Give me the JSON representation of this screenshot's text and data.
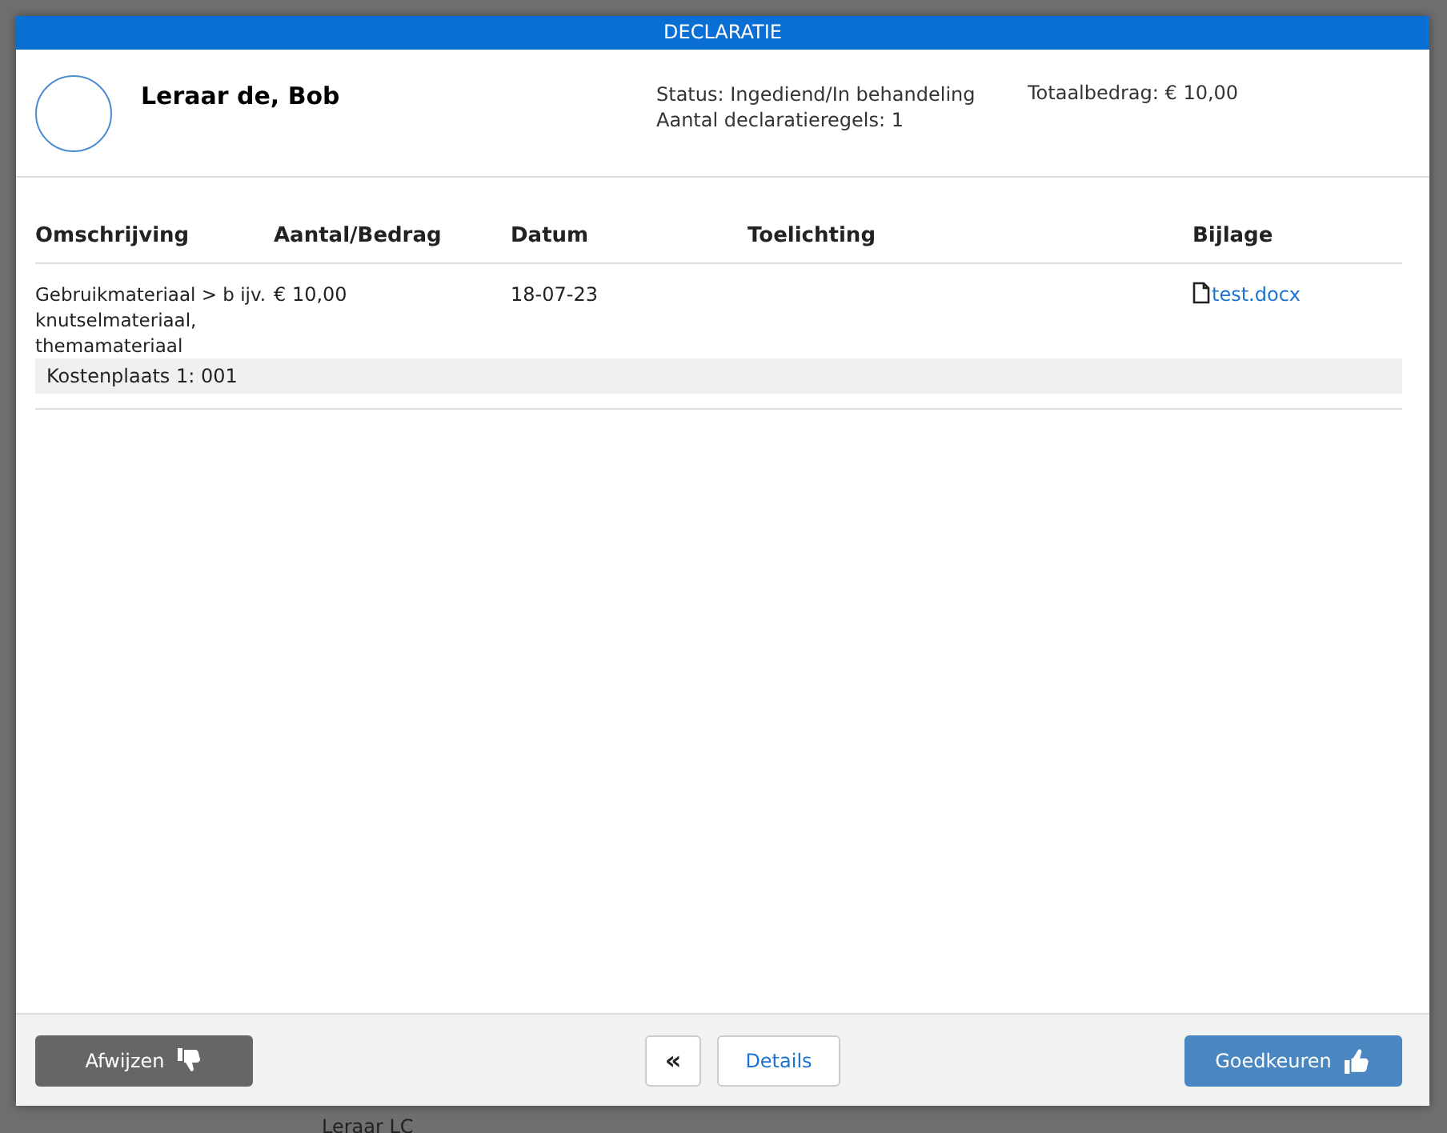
{
  "dialog": {
    "title": "DECLARATIE"
  },
  "person": {
    "name": "Leraar de, Bob",
    "status": "Status: Ingediend/In behandeling",
    "line_count": "Aantal declaratieregels: 1",
    "total": "Totaalbedrag: € 10,00"
  },
  "table": {
    "columns": [
      "Omschrijving",
      "Aantal/Bedrag",
      "Datum",
      "Toelichting",
      "Bijlage"
    ],
    "rows": [
      {
        "description": "Gebruikmateriaal > b ijv. knutselmateriaal, themamateriaal",
        "amount": "€ 10,00",
        "date": "18-07-23",
        "attachment": "test.docx",
        "cost_center": "Kostenplaats 1: 001"
      }
    ]
  },
  "footer": {
    "reject": "Afwijzen",
    "back": "«",
    "details": "Details",
    "approve": "Goedkeuren"
  },
  "background": {
    "text": "Leraar LC"
  }
}
